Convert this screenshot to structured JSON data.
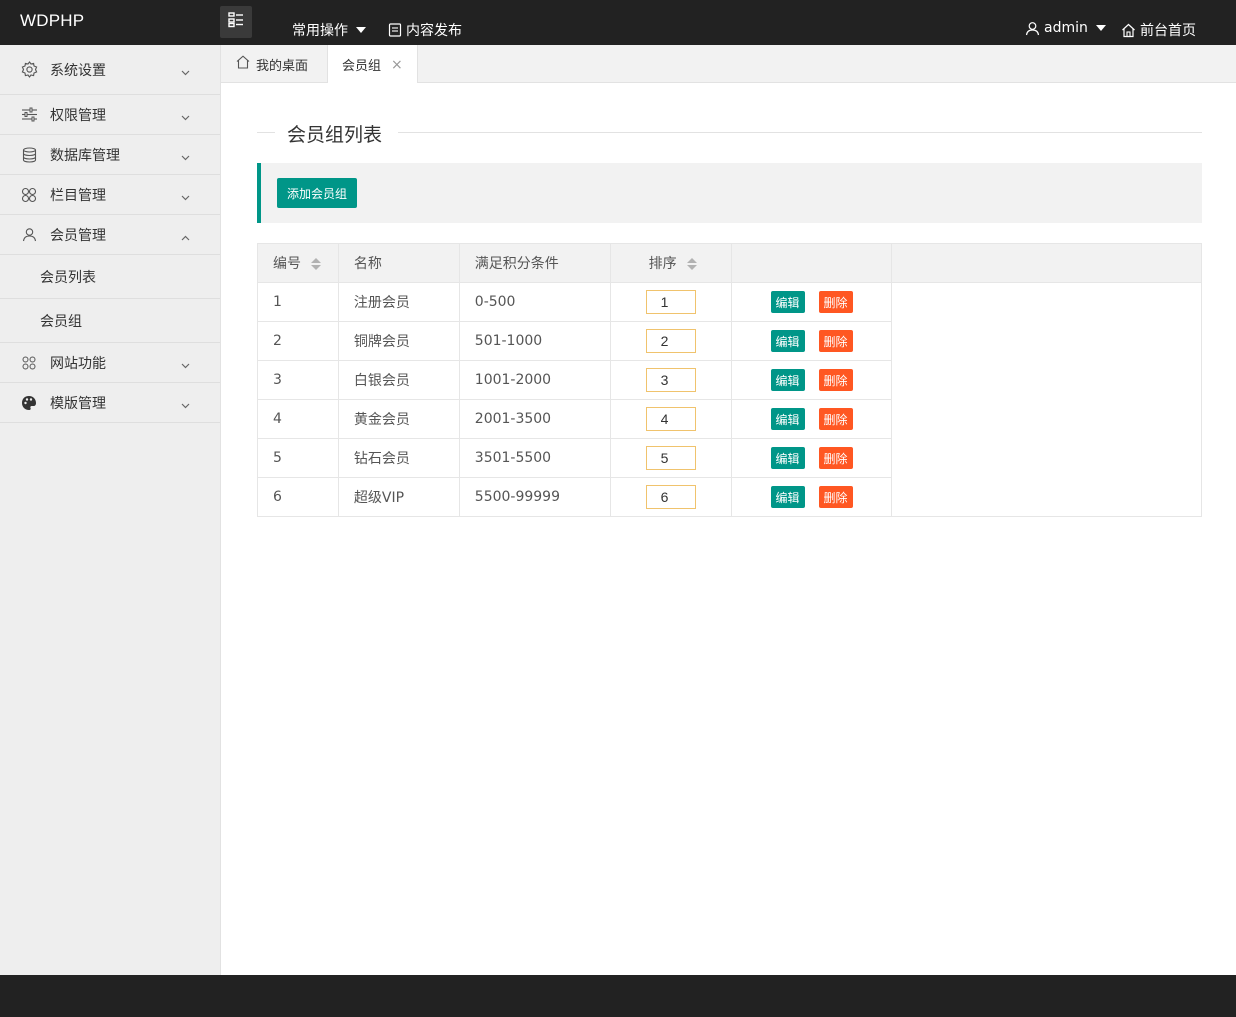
{
  "app": {
    "logo": "WDPHP"
  },
  "header": {
    "menu_common": "常用操作",
    "menu_publish": "内容发布",
    "user": "admin",
    "front_home": "前台首页"
  },
  "sidebar": {
    "items": [
      {
        "label": "系统设置",
        "icon": "gear-icon",
        "expanded": false
      },
      {
        "label": "权限管理",
        "icon": "sliders-icon",
        "expanded": false
      },
      {
        "label": "数据库管理",
        "icon": "database-icon",
        "expanded": false
      },
      {
        "label": "栏目管理",
        "icon": "apps-icon",
        "expanded": false
      },
      {
        "label": "会员管理",
        "icon": "user-icon",
        "expanded": true,
        "children": [
          {
            "label": "会员列表"
          },
          {
            "label": "会员组"
          }
        ]
      },
      {
        "label": "网站功能",
        "icon": "grid-icon",
        "expanded": false
      },
      {
        "label": "模版管理",
        "icon": "palette-icon",
        "expanded": false
      }
    ]
  },
  "tabs": [
    {
      "label": "我的桌面",
      "icon": "home-icon",
      "active": false
    },
    {
      "label": "会员组",
      "active": true,
      "close": "×"
    }
  ],
  "main": {
    "title": "会员组列表",
    "add_button": "添加会员组",
    "table": {
      "columns": [
        "编号",
        "名称",
        "满足积分条件",
        "排序",
        ""
      ],
      "rows": [
        {
          "id": "1",
          "name": "注册会员",
          "points": "0-500",
          "order": "1"
        },
        {
          "id": "2",
          "name": "铜牌会员",
          "points": "501-1000",
          "order": "2"
        },
        {
          "id": "3",
          "name": "白银会员",
          "points": "1001-2000",
          "order": "3"
        },
        {
          "id": "4",
          "name": "黄金会员",
          "points": "2001-3500",
          "order": "4"
        },
        {
          "id": "5",
          "name": "钻石会员",
          "points": "3501-5500",
          "order": "5"
        },
        {
          "id": "6",
          "name": "超级VIP",
          "points": "5500-99999",
          "order": "6"
        }
      ],
      "edit_label": "编辑",
      "delete_label": "删除"
    }
  },
  "colors": {
    "header_bg": "#222222",
    "accent": "#009688",
    "danger": "#ff5722",
    "sidebar_bg": "#eeeeee"
  }
}
